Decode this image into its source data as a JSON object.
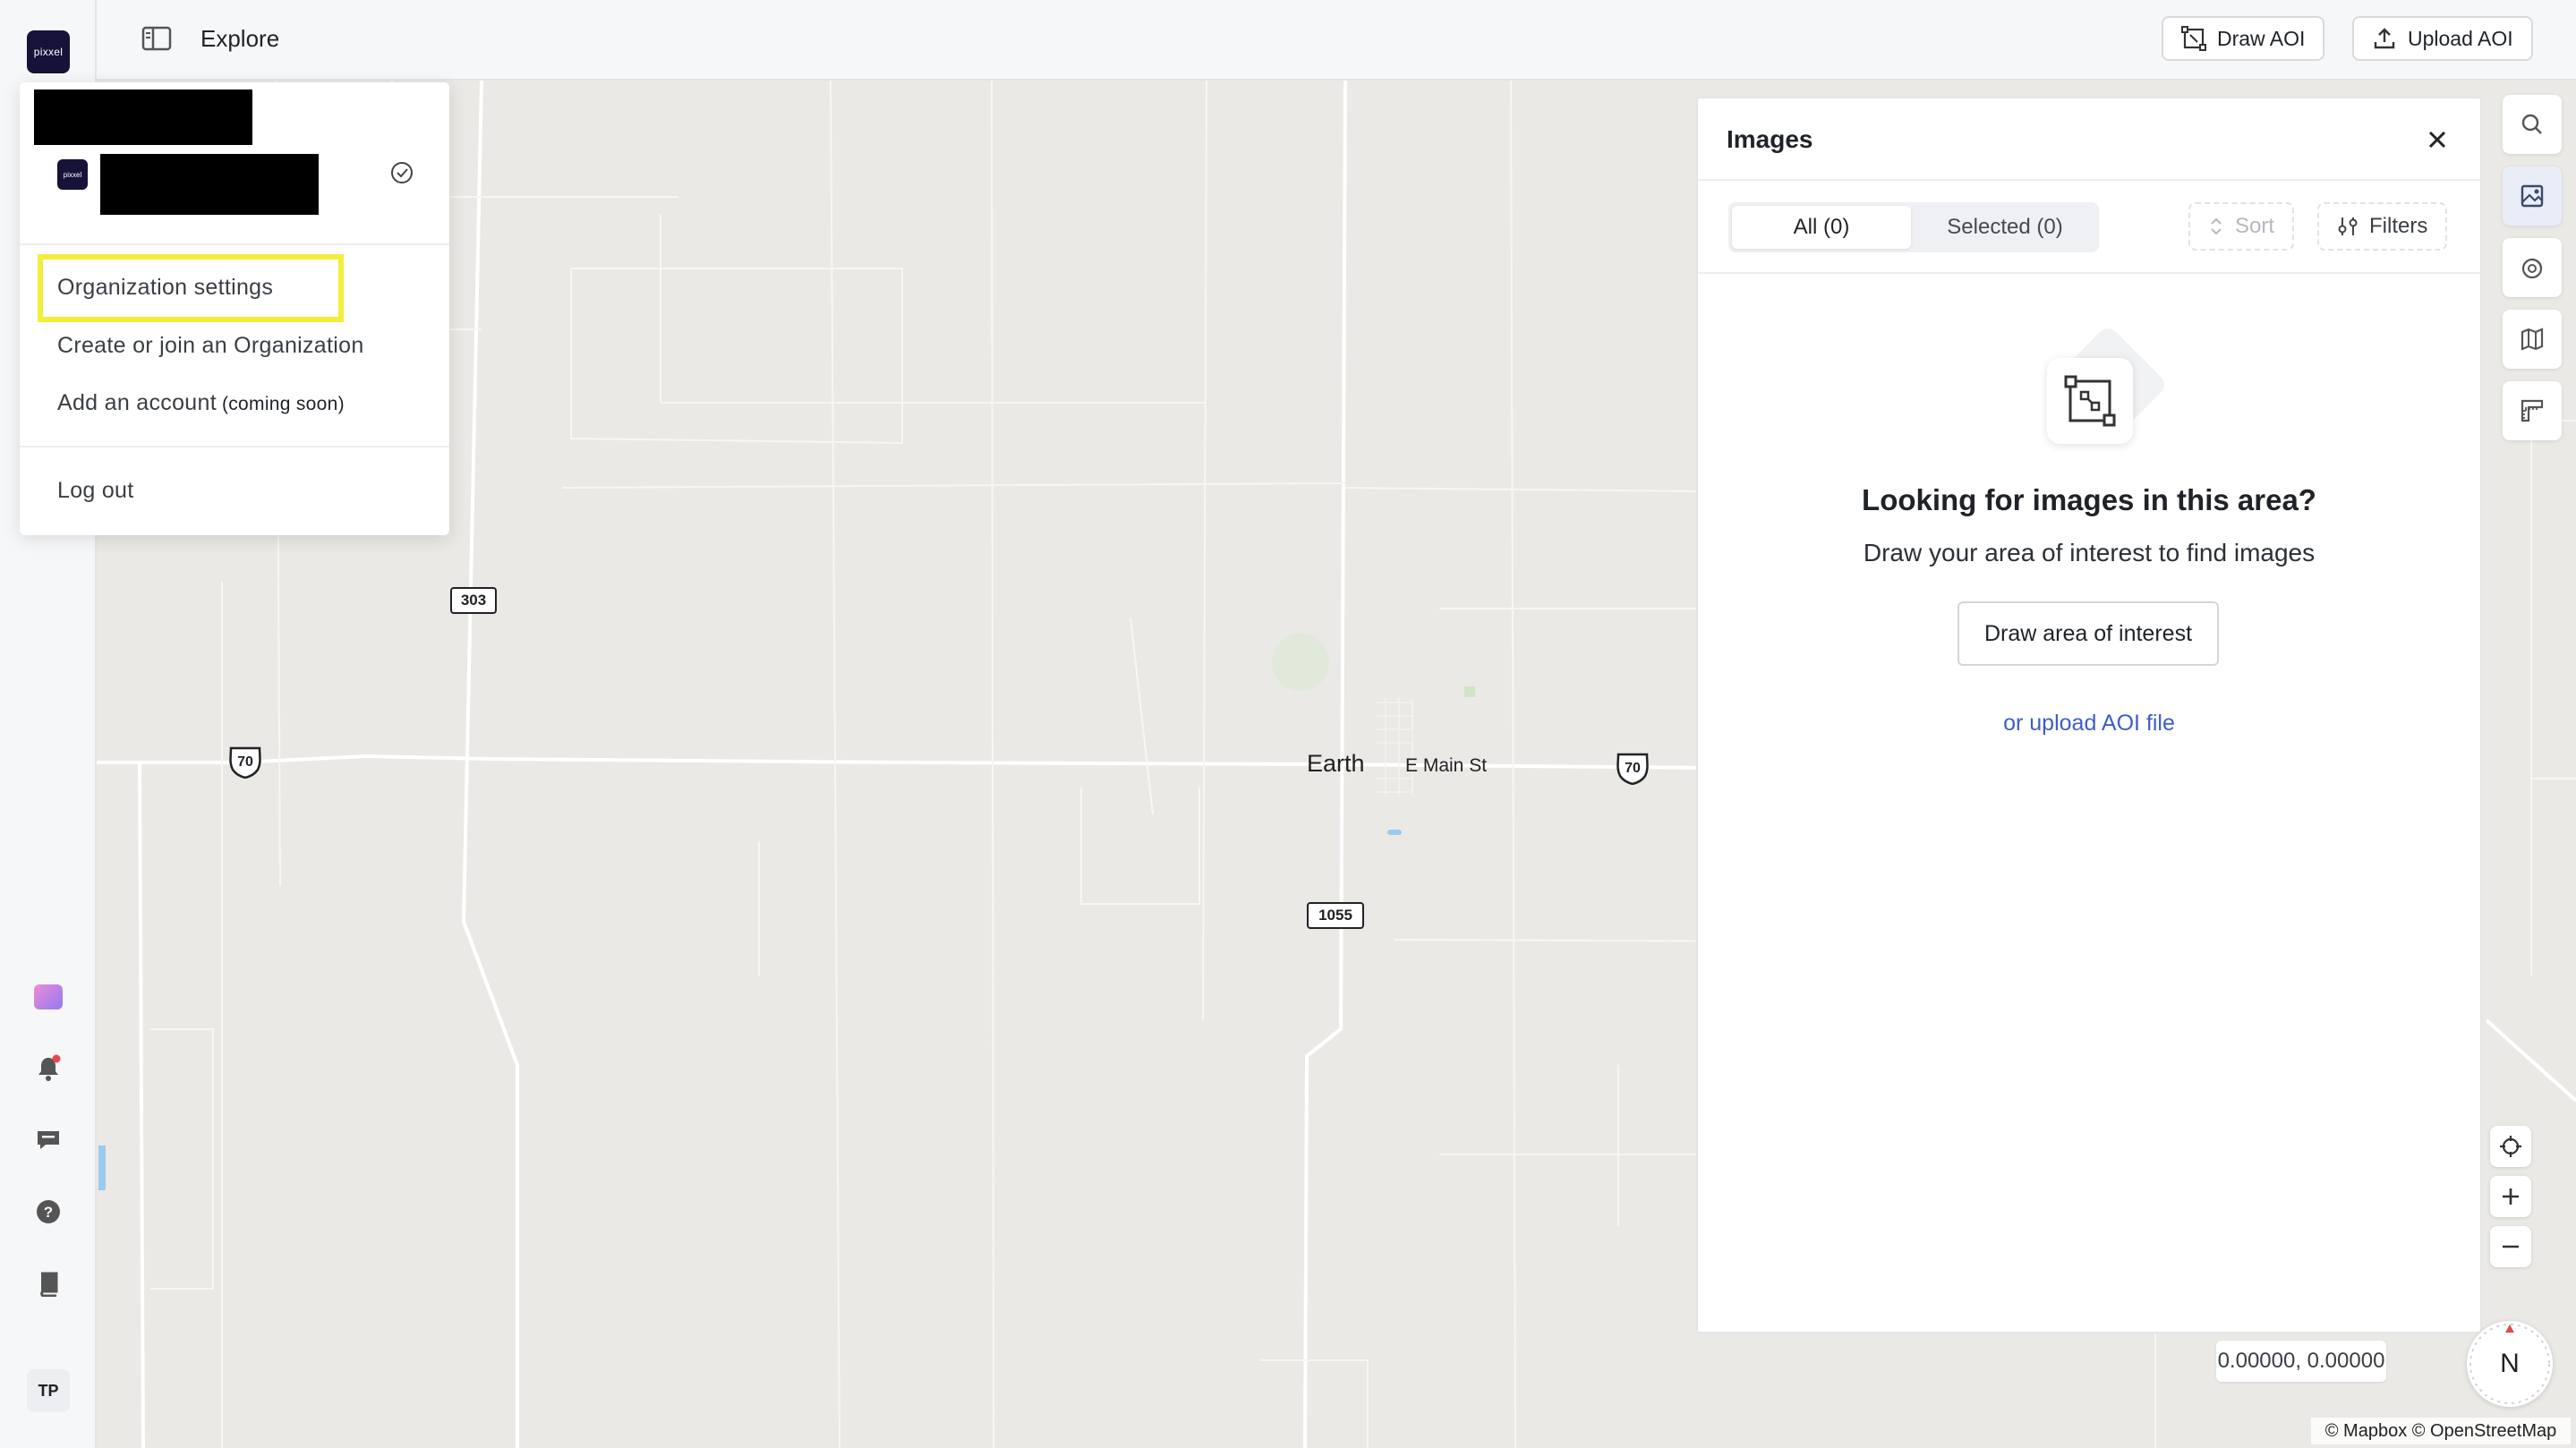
{
  "app": {
    "logo_text": "pixxel",
    "avatar_initials": "TP"
  },
  "topbar": {
    "title": "Explore",
    "draw_aoi_label": "Draw AOI",
    "upload_aoi_label": "Upload AOI"
  },
  "menu": {
    "org_logo_text": "pixxel",
    "items": [
      {
        "label": "Organization settings"
      },
      {
        "label": "Create or join an Organization"
      },
      {
        "label": "Add an account",
        "note": "(coming soon)"
      },
      {
        "label": "Log out"
      }
    ]
  },
  "map": {
    "labels": {
      "town": "Earth",
      "street": "E Main St"
    },
    "shields": {
      "s303": "303",
      "s1055": "1055",
      "us70a": "70",
      "us70b": "70"
    },
    "coords": "0.00000, 0.00000",
    "compass": "N",
    "attribution": "© Mapbox © OpenStreetMap"
  },
  "images_panel": {
    "title": "Images",
    "tabs": [
      {
        "label": "All (0)",
        "active": true
      },
      {
        "label": "Selected (0)",
        "active": false
      }
    ],
    "sort_label": "Sort",
    "filters_label": "Filters",
    "empty": {
      "heading": "Looking for images in this area?",
      "subtext": "Draw your area of interest to find images",
      "button": "Draw area of interest",
      "link": "or upload AOI file"
    }
  },
  "colors": {
    "brand": "#16123a",
    "highlight": "#f3ee3a",
    "link": "#3f5ec7",
    "map_bg": "#ebe9e5"
  }
}
